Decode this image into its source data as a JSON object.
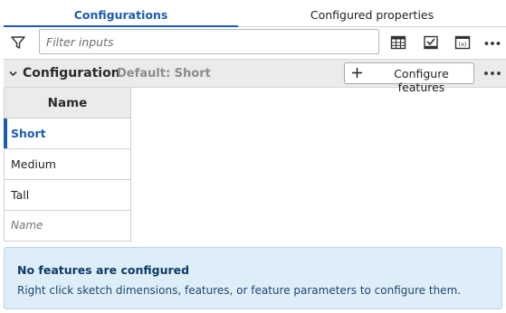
{
  "tabs": {
    "configurations": "Configurations",
    "configured_properties": "Configured properties"
  },
  "filter": {
    "placeholder": "Filter inputs",
    "value": ""
  },
  "toolbar": {
    "icons": [
      "filter-icon",
      "table-icon",
      "checkbox-icon",
      "variable-icon",
      "more-icon"
    ]
  },
  "section": {
    "title": "Configuration",
    "default_text": "Default: Short",
    "configure_button": "Configure features"
  },
  "table": {
    "header": "Name",
    "rows": [
      "Short",
      "Medium",
      "Tall"
    ],
    "active_row": "Short",
    "new_row_placeholder": "Name"
  },
  "info": {
    "title": "No features are configured",
    "body": "Right click sketch dimensions, features, or feature parameters to configure them."
  },
  "colors": {
    "accent": "#1d5bb3",
    "info_bg": "#deeef9",
    "header_bg": "#ebebeb"
  }
}
